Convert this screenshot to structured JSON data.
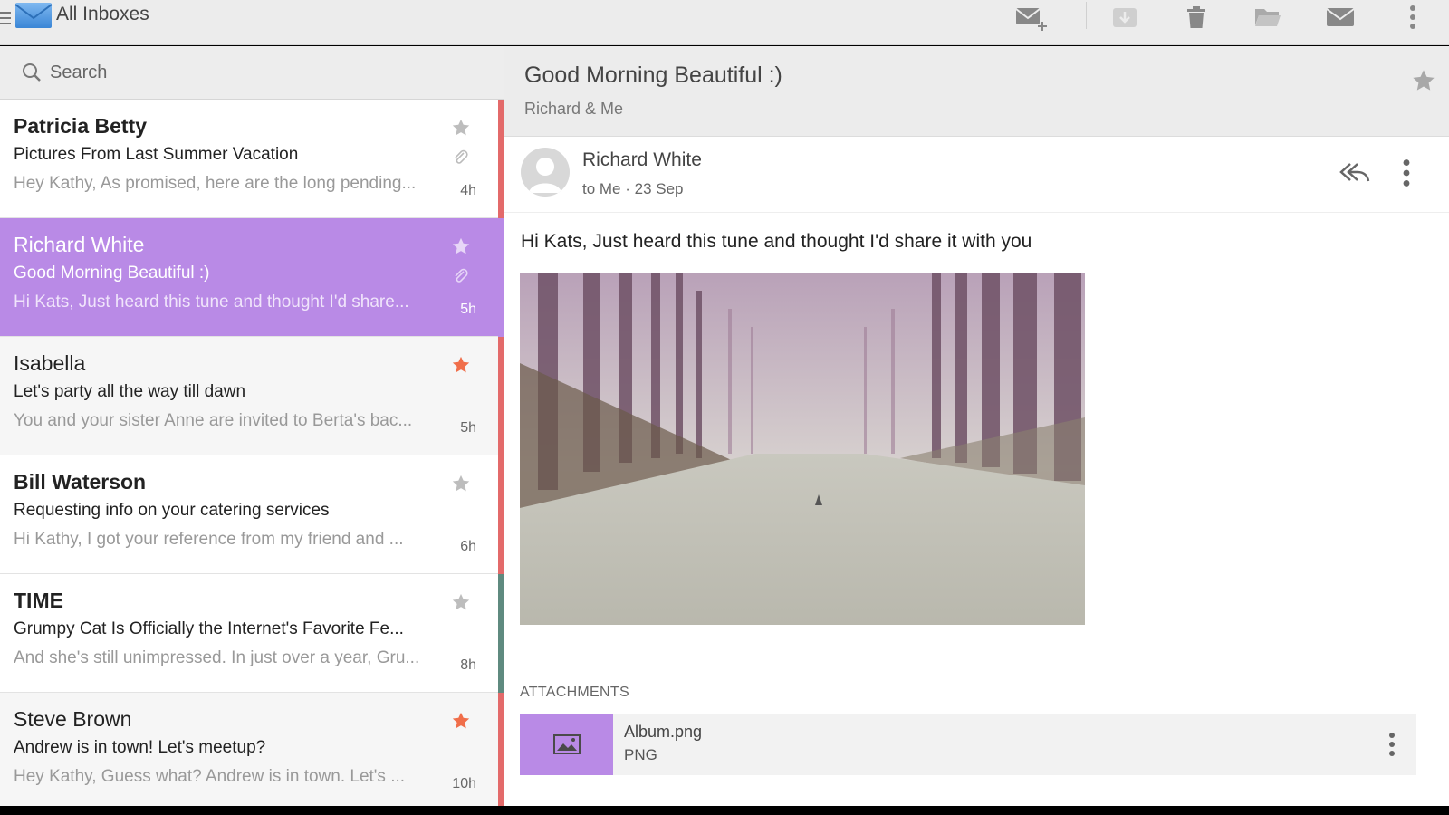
{
  "app": {
    "title": "All Inboxes"
  },
  "toolbar": {
    "icons": [
      "compose-mail-icon",
      "archive-icon",
      "trash-icon",
      "folder-icon",
      "mail-icon",
      "overflow-menu-icon"
    ]
  },
  "search": {
    "placeholder": "Search"
  },
  "messages": [
    {
      "sender": "Patricia Betty",
      "subject": "Pictures From Last Summer Vacation",
      "preview": "Hey Kathy, As promised, here are the long pending...",
      "time": "4h",
      "starred": false,
      "attachment": true,
      "unread": true,
      "accent": "#e36a6a"
    },
    {
      "sender": "Richard White",
      "subject": "Good Morning Beautiful :)",
      "preview": "Hi Kats, Just heard this tune and thought I'd share...",
      "time": "5h",
      "starred": false,
      "attachment": true,
      "unread": false,
      "accent": "#b98ae6"
    },
    {
      "sender": "Isabella",
      "subject": "Let's party all the way till dawn",
      "preview": "You and your sister Anne are invited to Berta's bac...",
      "time": "5h",
      "starred": true,
      "attachment": false,
      "unread": false,
      "accent": "#e36a6a"
    },
    {
      "sender": "Bill Waterson",
      "subject": "Requesting info on your catering services",
      "preview": "Hi Kathy, I got your reference from my friend and ...",
      "time": "6h",
      "starred": false,
      "attachment": false,
      "unread": true,
      "accent": "#e36a6a"
    },
    {
      "sender": "TIME",
      "subject": "Grumpy Cat Is Officially the Internet's Favorite Fe...",
      "preview": "And she's still unimpressed. In just over a year, Gru...",
      "time": "8h",
      "starred": false,
      "attachment": false,
      "unread": true,
      "accent": "#5f8a7f"
    },
    {
      "sender": "Steve Brown",
      "subject": "Andrew is in town! Let's meetup?",
      "preview": "Hey Kathy, Guess what? Andrew is in town. Let's ...",
      "time": "10h",
      "starred": true,
      "attachment": false,
      "unread": false,
      "accent": "#e36a6a"
    }
  ],
  "reader": {
    "subject": "Good Morning Beautiful :)",
    "participants": "Richard & Me",
    "from": "Richard White",
    "meta": "to Me · 23 Sep",
    "body": "Hi Kats, Just heard this tune and thought I'd share it with you",
    "attachments_label": "ATTACHMENTS",
    "attachment": {
      "name": "Album.png",
      "type": "PNG"
    }
  },
  "colors": {
    "accent_purple": "#b98ae6",
    "star_active": "#f06e4a",
    "star_inactive": "#bdbdbd",
    "unread_strip": "#e36a6a"
  }
}
